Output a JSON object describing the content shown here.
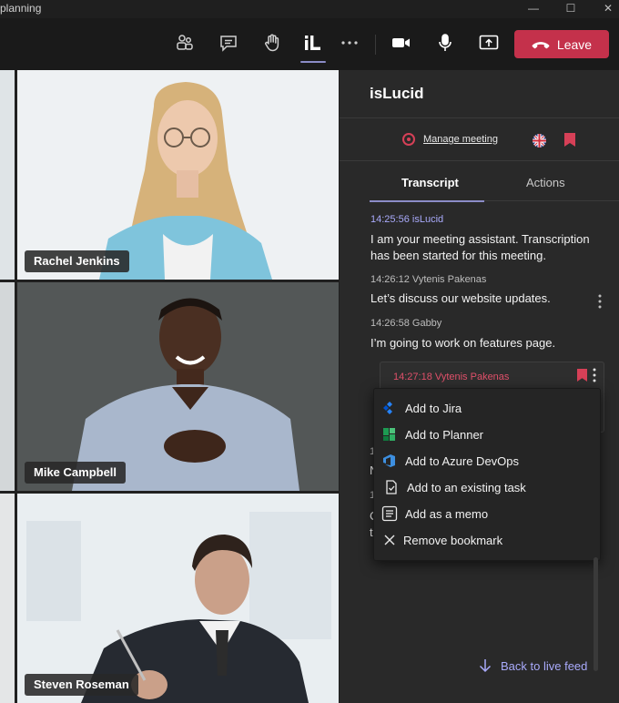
{
  "window": {
    "title_fragment": "planning"
  },
  "toolbar": {
    "icons": [
      "people-icon",
      "chat-icon",
      "raise-hand-icon",
      "islucid-app-icon",
      "more-icon",
      "camera-icon",
      "mic-icon",
      "share-icon"
    ],
    "leave_label": "Leave",
    "leave_color": "#c4314b"
  },
  "participants": [
    {
      "name": "Rachel Jenkins"
    },
    {
      "name": "Mike Campbell"
    },
    {
      "name": "Steven Roseman"
    }
  ],
  "panel": {
    "app_title": "isLucid",
    "manage_meeting": "Manage meeting",
    "tabs": [
      {
        "label": "Transcript",
        "active": true
      },
      {
        "label": "Actions",
        "active": false
      }
    ],
    "messages": [
      {
        "time": "14:25:56",
        "speaker": "isLucid",
        "text": "I am your meeting assistant. Transcription has been started for this meeting."
      },
      {
        "time": "14:26:12",
        "speaker": "Vytenis Pakenas",
        "text": "Let’s discuss our website updates."
      },
      {
        "time": "14:26:58",
        "speaker": "Gabby",
        "text": "I’m going to work on features page."
      }
    ],
    "bookmarked": {
      "time": "14:27:18",
      "speaker": "Vytenis Pakenas"
    },
    "context_menu": [
      {
        "label": "Add to Jira",
        "icon": "jira-icon"
      },
      {
        "label": "Add to Planner",
        "icon": "planner-icon"
      },
      {
        "label": "Add to Azure DevOps",
        "icon": "azure-devops-icon"
      },
      {
        "label": "Add to an existing task",
        "icon": "existing-task-icon"
      },
      {
        "label": "Add as a memo",
        "icon": "memo-icon"
      },
      {
        "label": "Remove bookmark",
        "icon": "close-icon"
      }
    ],
    "back_label": "Back to live feed",
    "accent_color": "#a9aafb",
    "bookmark_color": "#d64057"
  }
}
